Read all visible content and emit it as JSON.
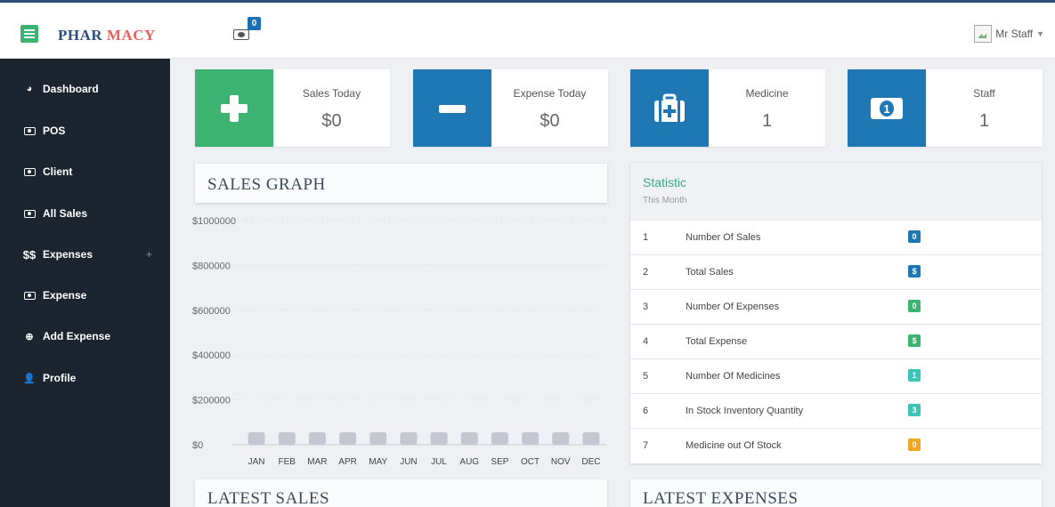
{
  "brand": {
    "part1": "PHAR",
    "part2": "MACY"
  },
  "header": {
    "cart_count": "0",
    "user_name": "Mr Staff"
  },
  "sidebar": {
    "items": [
      {
        "label": "Dashboard",
        "icon": "dashboard-icon"
      },
      {
        "label": "POS",
        "icon": "money-icon"
      },
      {
        "label": "Client",
        "icon": "money-icon"
      },
      {
        "label": "All Sales",
        "icon": "money-icon"
      },
      {
        "label": "Expenses",
        "icon": "dollar-icon",
        "expand": "+"
      },
      {
        "label": "Expense",
        "icon": "money-icon"
      },
      {
        "label": "Add Expense",
        "icon": "plus-circle-icon"
      },
      {
        "label": "Profile",
        "icon": "user-icon"
      }
    ]
  },
  "cards": [
    {
      "label": "Sales Today",
      "value": "$0",
      "color": "#3cb371",
      "icon": "plus-icon"
    },
    {
      "label": "Expense Today",
      "value": "$0",
      "color": "#1f78b4",
      "icon": "minus-icon"
    },
    {
      "label": "Medicine",
      "value": "1",
      "color": "#1f78b4",
      "icon": "medkit-icon"
    },
    {
      "label": "Staff",
      "value": "1",
      "color": "#1f78b4",
      "icon": "money-icon"
    }
  ],
  "sales_graph": {
    "title": "SALES GRAPH"
  },
  "chart_data": {
    "type": "bar",
    "title": "SALES GRAPH",
    "categories": [
      "JAN",
      "FEB",
      "MAR",
      "APR",
      "MAY",
      "JUN",
      "JUL",
      "AUG",
      "SEP",
      "OCT",
      "NOV",
      "DEC"
    ],
    "values": [
      0,
      0,
      0,
      0,
      0,
      0,
      0,
      0,
      0,
      0,
      0,
      0
    ],
    "ytick_labels": [
      "$0",
      "$200000",
      "$400000",
      "$600000",
      "$800000",
      "$1000000"
    ],
    "ylim": [
      0,
      1000000
    ],
    "grid": true,
    "bar_color": "#c3c7d0"
  },
  "statistic": {
    "title": "Statistic",
    "subtitle": "This Month",
    "rows": [
      {
        "num": "1",
        "label": "Number Of Sales",
        "badge": "0",
        "color": "#1f78b4"
      },
      {
        "num": "2",
        "label": "Total Sales",
        "badge": "$",
        "color": "#1f78b4"
      },
      {
        "num": "3",
        "label": "Number Of Expenses",
        "badge": "0",
        "color": "#3cb371"
      },
      {
        "num": "4",
        "label": "Total Expense",
        "badge": "$",
        "color": "#3cb371"
      },
      {
        "num": "5",
        "label": "Number Of Medicines",
        "badge": "1",
        "color": "#3cc3b8"
      },
      {
        "num": "6",
        "label": "In Stock Inventory Quantity",
        "badge": "3",
        "color": "#3cc3b8"
      },
      {
        "num": "7",
        "label": "Medicine out Of Stock",
        "badge": "0",
        "color": "#f0a820"
      }
    ]
  },
  "latest_sales": {
    "title": "LATEST SALES"
  },
  "latest_expenses": {
    "title": "LATEST EXPENSES"
  }
}
